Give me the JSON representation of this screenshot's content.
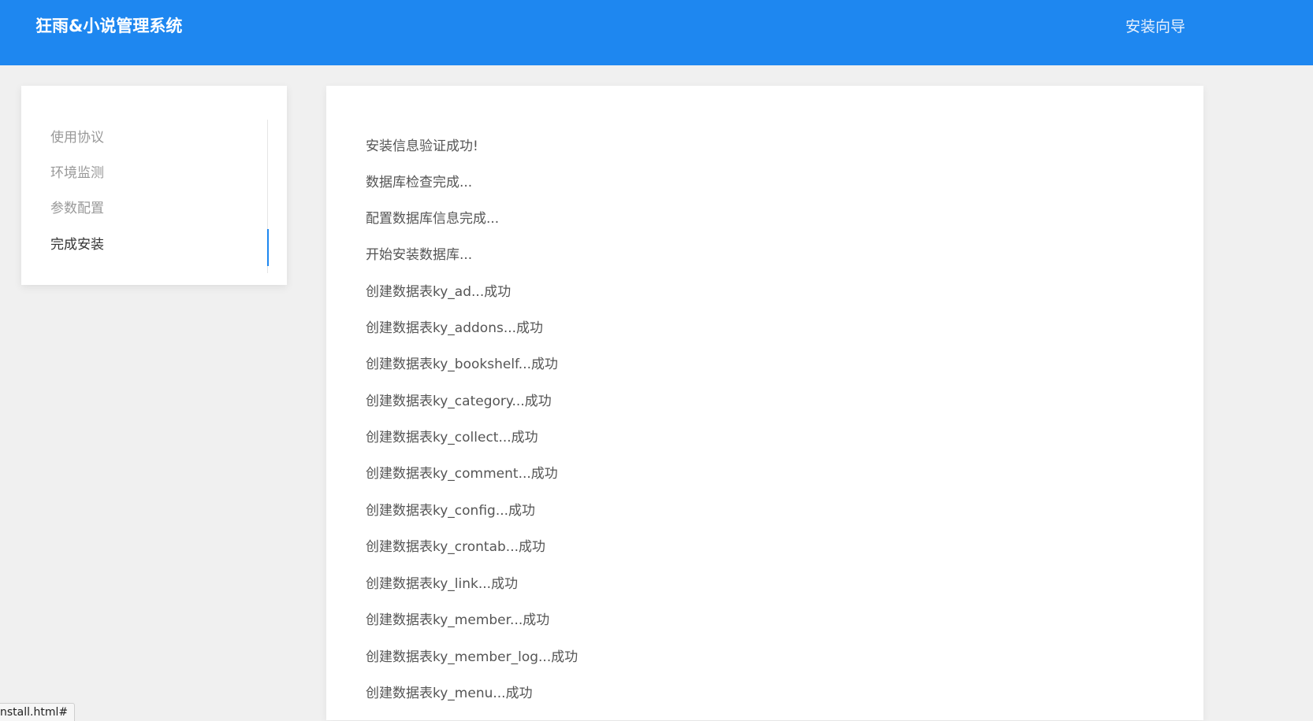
{
  "header": {
    "brand": "狂雨&小说管理系统",
    "wizard_link": "安装向导",
    "background": "#1e87f0"
  },
  "sidebar": {
    "steps": [
      {
        "label": "使用协议",
        "active": false
      },
      {
        "label": "环境监测",
        "active": false
      },
      {
        "label": "参数配置",
        "active": false
      },
      {
        "label": "完成安装",
        "active": true
      }
    ],
    "accent": "#1e87f0"
  },
  "main": {
    "log": [
      "安装信息验证成功!",
      "数据库检查完成...",
      "配置数据库信息完成...",
      "开始安装数据库...",
      "创建数据表ky_ad...成功",
      "创建数据表ky_addons...成功",
      "创建数据表ky_bookshelf...成功",
      "创建数据表ky_category...成功",
      "创建数据表ky_collect...成功",
      "创建数据表ky_comment...成功",
      "创建数据表ky_config...成功",
      "创建数据表ky_crontab...成功",
      "创建数据表ky_link...成功",
      "创建数据表ky_member...成功",
      "创建数据表ky_member_log...成功",
      "创建数据表ky_menu...成功"
    ]
  },
  "status_bar": {
    "url_text": "nstall.html#"
  }
}
